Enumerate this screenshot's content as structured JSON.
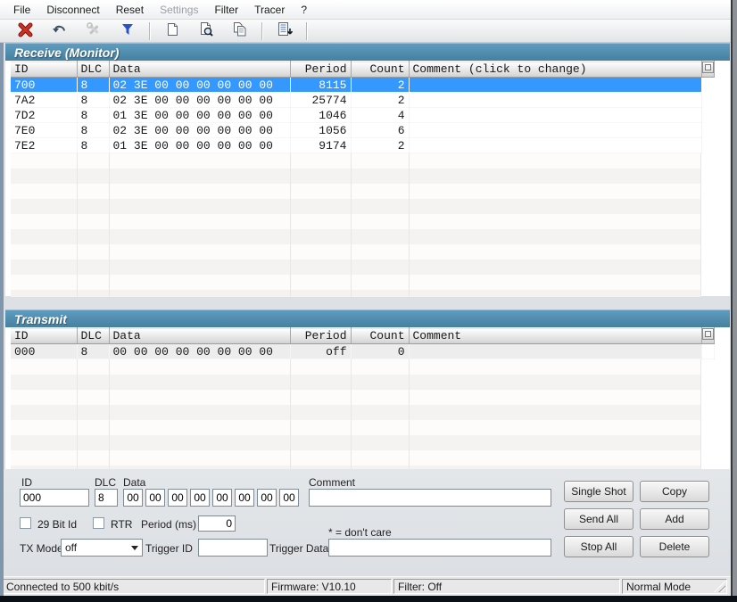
{
  "menu": {
    "items": [
      {
        "label": "File",
        "enabled": true
      },
      {
        "label": "Disconnect",
        "enabled": true
      },
      {
        "label": "Reset",
        "enabled": true
      },
      {
        "label": "Settings",
        "enabled": false
      },
      {
        "label": "Filter",
        "enabled": true
      },
      {
        "label": "Tracer",
        "enabled": true
      },
      {
        "label": "?",
        "enabled": true
      }
    ]
  },
  "toolbar": {
    "icons": [
      {
        "name": "disconnect-icon"
      },
      {
        "name": "undo-icon"
      },
      {
        "name": "settings-tools-icon",
        "disabled": true
      },
      {
        "name": "filter-icon"
      },
      {
        "name": "new-message-icon"
      },
      {
        "name": "preview-icon"
      },
      {
        "name": "copy-icon"
      },
      {
        "name": "log-export-icon"
      }
    ]
  },
  "receive": {
    "title": "Receive (Monitor)",
    "columns": {
      "id": "ID",
      "dlc": "DLC",
      "data": "Data",
      "period": "Period",
      "count": "Count",
      "comment": "Comment (click to change)"
    },
    "rows": [
      {
        "id": "700",
        "dlc": "8",
        "data": "02 3E 00 00 00 00 00 00",
        "period": "8115",
        "count": "2",
        "comment": ""
      },
      {
        "id": "7A2",
        "dlc": "8",
        "data": "02 3E 00 00 00 00 00 00",
        "period": "25774",
        "count": "2",
        "comment": ""
      },
      {
        "id": "7D2",
        "dlc": "8",
        "data": "01 3E 00 00 00 00 00 00",
        "period": "1046",
        "count": "4",
        "comment": ""
      },
      {
        "id": "7E0",
        "dlc": "8",
        "data": "02 3E 00 00 00 00 00 00",
        "period": "1056",
        "count": "6",
        "comment": ""
      },
      {
        "id": "7E2",
        "dlc": "8",
        "data": "01 3E 00 00 00 00 00 00",
        "period": "9174",
        "count": "2",
        "comment": ""
      }
    ]
  },
  "transmit": {
    "title": "Transmit",
    "columns": {
      "id": "ID",
      "dlc": "DLC",
      "data": "Data",
      "period": "Period",
      "count": "Count",
      "comment": "Comment"
    },
    "rows": [
      {
        "id": "000",
        "dlc": "8",
        "data": "00 00 00 00 00 00 00 00",
        "period": "off",
        "count": "0",
        "comment": ""
      }
    ]
  },
  "form": {
    "id_label": "ID",
    "id_value": "000",
    "dlc_label": "DLC",
    "dlc_value": "8",
    "data_label": "Data",
    "data_bytes": [
      "00",
      "00",
      "00",
      "00",
      "00",
      "00",
      "00",
      "00"
    ],
    "comment_label": "Comment",
    "comment_value": "",
    "bit29_label": "29 Bit Id",
    "rtr_label": "RTR",
    "period_label": "Period (ms)",
    "period_value": "0",
    "dont_care_note": "* = don't care",
    "txmode_label": "TX Mode",
    "txmode_value": "off",
    "trigger_id_label": "Trigger ID",
    "trigger_id_value": "",
    "trigger_data_label": "Trigger Data",
    "trigger_data_value": "",
    "buttons": [
      "Single Shot",
      "Copy",
      "Send All",
      "Add",
      "Stop All",
      "Delete"
    ]
  },
  "statusbar": {
    "connection": "Connected to 500 kbit/s",
    "firmware": "Firmware: V10.10",
    "filter": "Filter: Off",
    "mode": "Normal Mode"
  },
  "colors": {
    "header_teal": "#4d8bb0",
    "selection_blue": "#3598ff"
  }
}
